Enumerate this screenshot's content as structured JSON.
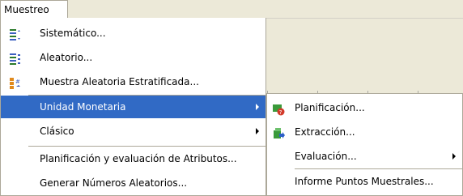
{
  "menubar": {
    "label": "Muestreo"
  },
  "main_menu": {
    "items": [
      {
        "label": "Sistemático...",
        "icon": "systematic-sampling-icon"
      },
      {
        "label": "Aleatorio...",
        "icon": "random-sampling-icon"
      },
      {
        "label": "Muestra Aleatoria Estratificada...",
        "icon": "stratified-sampling-icon"
      },
      {
        "label": "Unidad Monetaria"
      },
      {
        "label": "Clásico"
      },
      {
        "label": "Planificación y evaluación de Atributos..."
      },
      {
        "label": "Generar Números Aleatorios..."
      }
    ]
  },
  "sub_menu": {
    "items": [
      {
        "label": "Planificación...",
        "icon": "planning-icon"
      },
      {
        "label": "Extracción...",
        "icon": "extraction-icon"
      },
      {
        "label": "Evaluación..."
      },
      {
        "label": "Informe Puntos Muestrales..."
      }
    ]
  },
  "colors": {
    "highlight": "#316ac5",
    "menu_border": "#aca899",
    "background": "#ece9d8"
  }
}
